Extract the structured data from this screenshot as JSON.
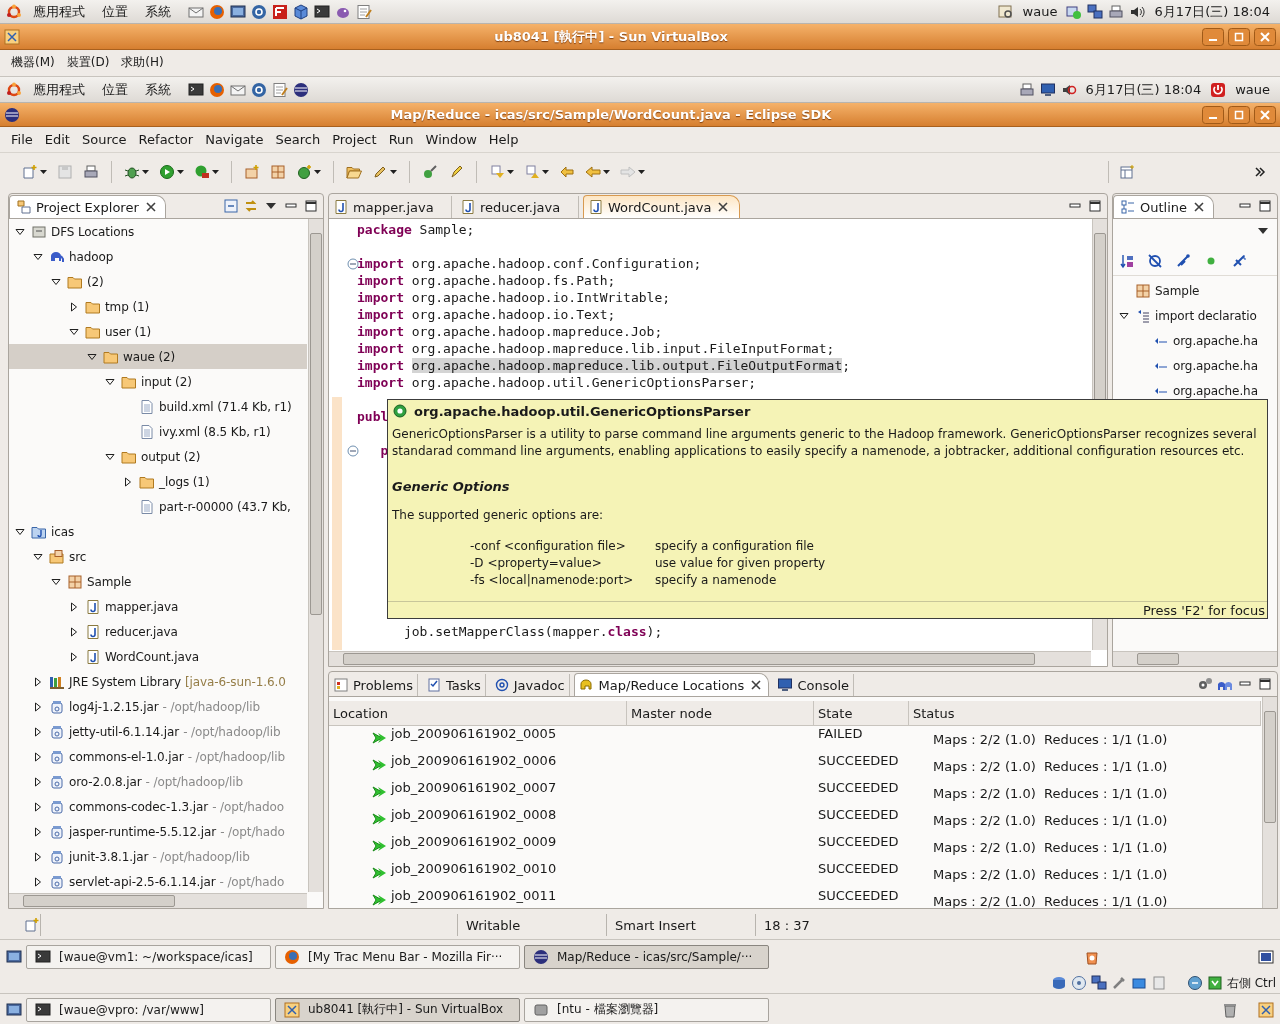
{
  "host_panel": {
    "menus": [
      "應用程式",
      "位置",
      "系統"
    ],
    "user": "waue",
    "clock": "6月17日(三) 18:04"
  },
  "vbox_window": {
    "title": "ub8041 [執行中] - Sun VirtualBox",
    "menus": [
      "機器(M)",
      "裝置(D)",
      "求助(H)"
    ],
    "host_key": "右側 Ctrl"
  },
  "guest_panel": {
    "menus": [
      "應用程式",
      "位置",
      "系統"
    ],
    "clock": "6月17日(三) 18:04",
    "user": "waue"
  },
  "eclipse": {
    "title": "Map/Reduce - icas/src/Sample/WordCount.java - Eclipse SDK",
    "menus": [
      "File",
      "Edit",
      "Source",
      "Refactor",
      "Navigate",
      "Search",
      "Project",
      "Run",
      "Window",
      "Help"
    ]
  },
  "project_explorer": {
    "title": "Project Explorer",
    "tree": [
      {
        "label": "DFS Locations",
        "kind": "dfs",
        "expanded": true,
        "selected": false,
        "children": [
          {
            "label": "hadoop",
            "kind": "elephant",
            "expanded": true,
            "selected": false,
            "children": [
              {
                "label": "(2)",
                "kind": "folder",
                "expanded": true,
                "selected": false,
                "children": [
                  {
                    "label": "tmp (1)",
                    "kind": "folder",
                    "expanded": false,
                    "selected": false
                  },
                  {
                    "label": "user (1)",
                    "kind": "folder",
                    "expanded": true,
                    "selected": false,
                    "children": [
                      {
                        "label": "waue (2)",
                        "kind": "folder",
                        "expanded": true,
                        "selected": true,
                        "children": [
                          {
                            "label": "input (2)",
                            "kind": "folder",
                            "expanded": true,
                            "selected": false,
                            "children": [
                              {
                                "label": "build.xml (71.4 Kb, r1)",
                                "kind": "file",
                                "selected": false
                              },
                              {
                                "label": "ivy.xml (8.5 Kb, r1)",
                                "kind": "file",
                                "selected": false
                              }
                            ]
                          },
                          {
                            "label": "output (2)",
                            "kind": "folder",
                            "expanded": true,
                            "selected": false,
                            "children": [
                              {
                                "label": "_logs (1)",
                                "kind": "folder",
                                "expanded": false,
                                "selected": false
                              },
                              {
                                "label": "part-r-00000 (43.7 Kb,",
                                "kind": "file",
                                "selected": false
                              }
                            ]
                          }
                        ]
                      }
                    ]
                  }
                ]
              }
            ]
          }
        ]
      },
      {
        "label": "icas",
        "kind": "project",
        "expanded": true,
        "selected": false,
        "children": [
          {
            "label": "src",
            "kind": "src",
            "expanded": true,
            "selected": false,
            "children": [
              {
                "label": "Sample",
                "kind": "package",
                "expanded": true,
                "selected": false,
                "children": [
                  {
                    "label": "mapper.java",
                    "kind": "java",
                    "expanded": false,
                    "selected": false
                  },
                  {
                    "label": "reducer.java",
                    "kind": "java",
                    "expanded": false,
                    "selected": false
                  },
                  {
                    "label": "WordCount.java",
                    "kind": "java",
                    "expanded": false,
                    "selected": false
                  }
                ]
              }
            ]
          },
          {
            "label": "JRE System Library",
            "detail": "[java-6-sun-1.6.0",
            "kind": "library",
            "expanded": false,
            "selected": false
          },
          {
            "label": "log4j-1.2.15.jar",
            "detail": "- /opt/hadoop/lib",
            "kind": "jar",
            "expanded": false,
            "selected": false
          },
          {
            "label": "jetty-util-6.1.14.jar",
            "detail": "- /opt/hadoop/lib",
            "kind": "jar",
            "expanded": false,
            "selected": false
          },
          {
            "label": "commons-el-1.0.jar",
            "detail": "- /opt/hadoop/lib",
            "kind": "jar",
            "expanded": false,
            "selected": false
          },
          {
            "label": "oro-2.0.8.jar",
            "detail": "- /opt/hadoop/lib",
            "kind": "jar",
            "expanded": false,
            "selected": false
          },
          {
            "label": "commons-codec-1.3.jar",
            "detail": "- /opt/hadoo",
            "kind": "jar",
            "expanded": false,
            "selected": false
          },
          {
            "label": "jasper-runtime-5.5.12.jar",
            "detail": "- /opt/hado",
            "kind": "jar",
            "expanded": false,
            "selected": false
          },
          {
            "label": "junit-3.8.1.jar",
            "detail": "- /opt/hadoop/lib",
            "kind": "jar",
            "expanded": false,
            "selected": false
          },
          {
            "label": "servlet-api-2.5-6.1.14.jar",
            "detail": "- /opt/hado",
            "kind": "jar",
            "expanded": false,
            "selected": false
          }
        ]
      }
    ]
  },
  "editor": {
    "tabs": [
      {
        "label": "mapper.java",
        "selected": false
      },
      {
        "label": "reducer.java",
        "selected": false
      },
      {
        "label": "WordCount.java",
        "selected": true
      }
    ],
    "code_top": [
      {
        "kind": "code",
        "fold_marker": false,
        "segments": [
          {
            "kind": "keyword",
            "text": "package"
          },
          {
            "kind": "plain",
            "text": " Sample;"
          }
        ]
      },
      {
        "kind": "blank"
      },
      {
        "kind": "code",
        "fold_marker": true,
        "segments": [
          {
            "kind": "keyword",
            "text": "import"
          },
          {
            "kind": "plain",
            "text": " org.apache.hadoop.conf.Configuration;"
          }
        ]
      },
      {
        "kind": "code",
        "fold_marker": false,
        "segments": [
          {
            "kind": "keyword",
            "text": "import"
          },
          {
            "kind": "plain",
            "text": " org.apache.hadoop.fs.Path;"
          }
        ]
      },
      {
        "kind": "code",
        "fold_marker": false,
        "segments": [
          {
            "kind": "keyword",
            "text": "import"
          },
          {
            "kind": "plain",
            "text": " org.apache.hadoop.io.IntWritable;"
          }
        ]
      },
      {
        "kind": "code",
        "fold_marker": false,
        "segments": [
          {
            "kind": "keyword",
            "text": "import"
          },
          {
            "kind": "plain",
            "text": " org.apache.hadoop.io.Text;"
          }
        ]
      },
      {
        "kind": "code",
        "fold_marker": false,
        "segments": [
          {
            "kind": "keyword",
            "text": "import"
          },
          {
            "kind": "plain",
            "text": " org.apache.hadoop.mapreduce.Job;"
          }
        ]
      },
      {
        "kind": "code",
        "fold_marker": false,
        "segments": [
          {
            "kind": "keyword",
            "text": "import"
          },
          {
            "kind": "plain",
            "text": " org.apache.hadoop.mapreduce.lib.input.FileInputFormat;"
          }
        ]
      },
      {
        "kind": "code",
        "fold_marker": false,
        "segments": [
          {
            "kind": "keyword",
            "text": "import"
          },
          {
            "kind": "highlight",
            "text": "org.apache.hadoop.mapreduce.lib.output.FileOutputFormat",
            "space_before": true
          },
          {
            "kind": "plain",
            "text": ";"
          }
        ]
      },
      {
        "kind": "code",
        "fold_marker": false,
        "segments": [
          {
            "kind": "keyword",
            "text": "import"
          },
          {
            "kind": "plain",
            "text": " org.apache.hadoop.util.GenericOptionsParser;"
          }
        ]
      },
      {
        "kind": "blank"
      },
      {
        "kind": "code",
        "fold_marker": false,
        "segments": [
          {
            "kind": "keyword",
            "text": "publ"
          }
        ]
      },
      {
        "kind": "blank"
      },
      {
        "kind": "code",
        "fold_marker": true,
        "indented": true,
        "segments": [
          {
            "kind": "keyword",
            "text": "p"
          }
        ]
      }
    ],
    "code_bottom": [
      {
        "kind": "code",
        "fold_marker": false,
        "segments": [
          {
            "kind": "plain",
            "text": "      job.setMapperClass(mapper."
          },
          {
            "kind": "keyword",
            "text": "class"
          },
          {
            "kind": "plain",
            "text": ");"
          }
        ]
      }
    ]
  },
  "javadoc_hover": {
    "title": "org.apache.hadoop.util.GenericOptionsParser",
    "description": "GenericOptionsParser is a utility to parse command line arguments generic to the Hadoop framework. GenericOptionsParser recognizes several standarad command line arguments, enabling applications to easily specify a namenode, a jobtracker, additional configuration resources etc.",
    "heading": "Generic Options",
    "intro": "The supported generic options are:",
    "options": [
      {
        "option": "-conf <configuration file>",
        "description": "specify a configuration file"
      },
      {
        "option": "-D <property=value>",
        "description": "use value for given property"
      },
      {
        "option": "-fs <local|namenode:port>",
        "description": "specify a namenode"
      }
    ],
    "footer": "Press 'F2' for focus"
  },
  "outline": {
    "title": "Outline",
    "tree": [
      {
        "label": "Sample",
        "kind": "package",
        "selected": false
      },
      {
        "label": "import declaratio",
        "kind": "imports",
        "expanded": true,
        "selected": false,
        "children": [
          {
            "label": "org.apache.ha",
            "kind": "import",
            "selected": false
          },
          {
            "label": "org.apache.ha",
            "kind": "import",
            "selected": false
          },
          {
            "label": "org.apache.ha",
            "kind": "import",
            "selected": false
          }
        ]
      }
    ]
  },
  "bottom_view": {
    "tabs": [
      {
        "label": "Problems",
        "kind": "problems",
        "selected": false
      },
      {
        "label": "Tasks",
        "kind": "tasks",
        "selected": false
      },
      {
        "label": "Javadoc",
        "kind": "javadoc",
        "selected": false
      },
      {
        "label": "Map/Reduce Locations",
        "kind": "mapreduce",
        "selected": true
      },
      {
        "label": "Console",
        "kind": "console",
        "selected": false
      }
    ],
    "columns": [
      "Location",
      "Master node",
      "State",
      "Status"
    ],
    "rows": [
      {
        "location": "job_200906161902_0005",
        "state": "FAILED",
        "status": "Maps : 2/2 (1.0)  Reduces : 1/1 (1.0)"
      },
      {
        "location": "job_200906161902_0006",
        "state": "SUCCEEDED",
        "status": "Maps : 2/2 (1.0)  Reduces : 1/1 (1.0)"
      },
      {
        "location": "job_200906161902_0007",
        "state": "SUCCEEDED",
        "status": "Maps : 2/2 (1.0)  Reduces : 1/1 (1.0)"
      },
      {
        "location": "job_200906161902_0008",
        "state": "SUCCEEDED",
        "status": "Maps : 2/2 (1.0)  Reduces : 1/1 (1.0)"
      },
      {
        "location": "job_200906161902_0009",
        "state": "SUCCEEDED",
        "status": "Maps : 2/2 (1.0)  Reduces : 1/1 (1.0)"
      },
      {
        "location": "job_200906161902_0010",
        "state": "SUCCEEDED",
        "status": "Maps : 2/2 (1.0)  Reduces : 1/1 (1.0)"
      },
      {
        "location": "job_200906161902_0011",
        "state": "SUCCEEDED",
        "status": "Maps : 2/2 (1.0)  Reduces : 1/1 (1.0)"
      }
    ]
  },
  "status_bar": {
    "mode": "Writable",
    "insert_mode": "Smart Insert",
    "position": "18 : 37"
  },
  "guest_taskbar": {
    "tasks": [
      {
        "label": "[waue@vm1: ~/workspace/icas]",
        "kind": "terminal",
        "selected": false
      },
      {
        "label": "[My Trac Menu Bar - Mozilla Fir···",
        "kind": "browser",
        "selected": false
      },
      {
        "label": "Map/Reduce - icas/src/Sample/···",
        "kind": "eclipse",
        "selected": true
      }
    ]
  },
  "host_taskbar": {
    "tasks": [
      {
        "label": "[waue@vpro: /var/www]",
        "kind": "terminal",
        "selected": false
      },
      {
        "label": "ub8041 [執行中] - Sun VirtualBox",
        "kind": "vbox",
        "selected": true
      },
      {
        "label": "[ntu - 檔案瀏覽器]",
        "kind": "files",
        "selected": false
      }
    ]
  }
}
